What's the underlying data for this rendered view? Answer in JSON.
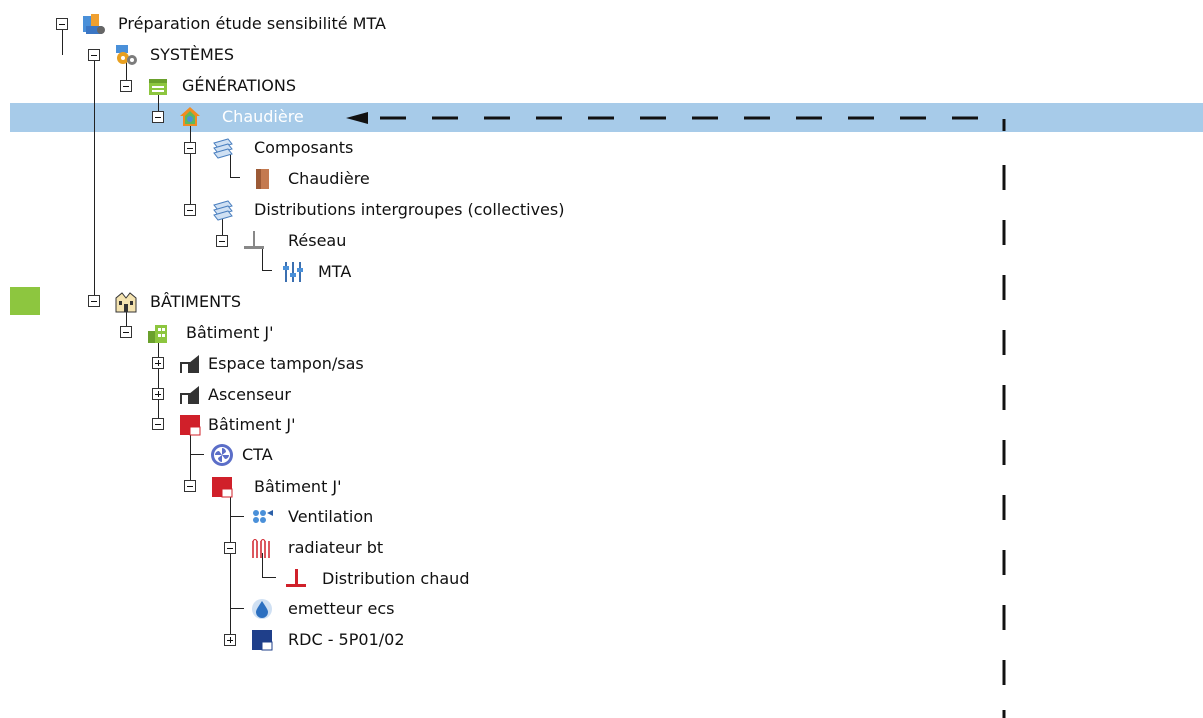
{
  "selection_color": "#a7cbe9",
  "marker_color": "#8dc63f",
  "tree": {
    "root": {
      "label": "Préparation étude sensibilité MTA",
      "icon": "project-icon"
    },
    "systemes": {
      "label": "SYSTÈMES",
      "icon": "systems-gear-icon"
    },
    "generations": {
      "label": "GÉNÉRATIONS",
      "icon": "generations-icon"
    },
    "chaudiere_gen": {
      "label": "Chaudière",
      "icon": "boiler-house-icon",
      "selected": true
    },
    "composants": {
      "label": "Composants",
      "icon": "layers-icon"
    },
    "chaudiere_comp": {
      "label": "Chaudière",
      "icon": "boiler-unit-icon"
    },
    "distributions": {
      "label": "Distributions intergroupes (collectives)",
      "icon": "layers-icon"
    },
    "reseau": {
      "label": "Réseau",
      "icon": "network-pipe-icon"
    },
    "mta": {
      "label": "MTA",
      "icon": "mta-icon"
    },
    "batiments": {
      "label": "BÂTIMENTS",
      "icon": "buildings-icon"
    },
    "batiment_j1": {
      "label": "Bâtiment J'",
      "icon": "building-green-icon"
    },
    "espace_tampon": {
      "label": "Espace tampon/sas",
      "icon": "stair-icon"
    },
    "ascenseur": {
      "label": "Ascenseur",
      "icon": "stair-icon"
    },
    "batiment_j2": {
      "label": "Bâtiment J'",
      "icon": "building-red-icon"
    },
    "cta": {
      "label": "CTA",
      "icon": "fan-icon"
    },
    "batiment_j3": {
      "label": "Bâtiment J'",
      "icon": "building-red-icon"
    },
    "ventilation": {
      "label": "Ventilation",
      "icon": "ventilation-icon"
    },
    "radiateur": {
      "label": "radiateur bt",
      "icon": "radiator-icon"
    },
    "distribution_chaud": {
      "label": "Distribution chaud",
      "icon": "hot-pipe-icon"
    },
    "emetteur": {
      "label": "emetteur ecs",
      "icon": "water-drop-icon"
    },
    "rdc": {
      "label": "RDC - 5P01/02",
      "icon": "floor-icon"
    }
  }
}
